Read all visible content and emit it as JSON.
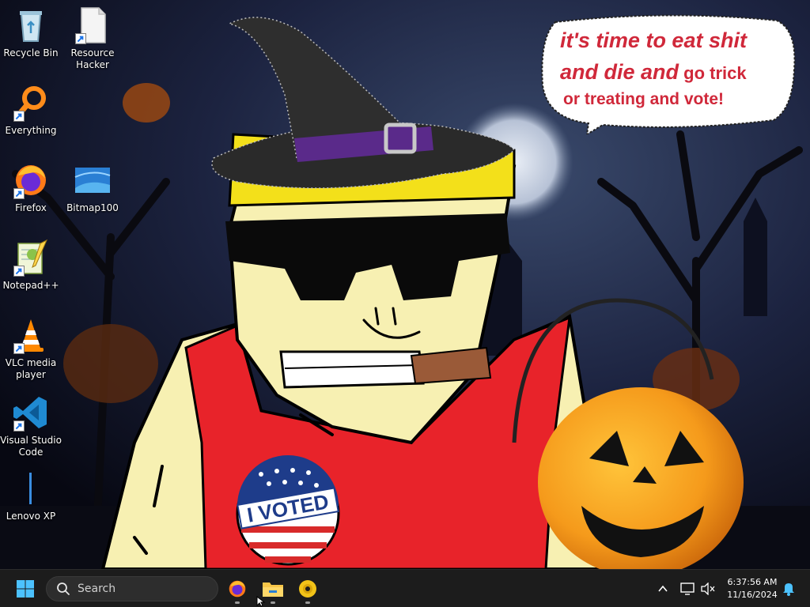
{
  "desktop": {
    "icons": [
      {
        "label": "Recycle Bin",
        "icon": "recycle-bin-icon",
        "shortcut": false
      },
      {
        "label": "Resource Hacker",
        "icon": "resource-hacker-icon",
        "shortcut": true
      },
      {
        "label": "Everything",
        "icon": "everything-search-icon",
        "shortcut": true
      },
      {
        "label": "Firefox",
        "icon": "firefox-icon",
        "shortcut": true
      },
      {
        "label": "Bitmap100",
        "icon": "bitmap-image-icon",
        "shortcut": false
      },
      {
        "label": "Notepad++",
        "icon": "notepad-plus-plus-icon",
        "shortcut": true
      },
      {
        "label": "VLC media player",
        "icon": "vlc-cone-icon",
        "shortcut": true
      },
      {
        "label": "Visual Studio Code",
        "icon": "vscode-icon",
        "shortcut": true
      },
      {
        "label": "Lenovo XP",
        "icon": "lenovo-xp-icon",
        "shortcut": false
      }
    ]
  },
  "wallpaper": {
    "speech_bubble": {
      "line1": "it's time to eat shit",
      "line2_big": "and die and",
      "line2_small": " go trick",
      "line3": "or treating and vote!"
    },
    "sticker_text": "I VOTED",
    "colors": {
      "speech_text": "#d0283a",
      "tank_top": "#e8232a",
      "skin": "#f7f0b2",
      "pumpkin": "#f59a1b"
    }
  },
  "taskbar": {
    "search_placeholder": "Search",
    "pinned": [
      {
        "name": "firefox-taskbar-button",
        "icon": "firefox-icon"
      },
      {
        "name": "file-explorer-taskbar-button",
        "icon": "folder-icon"
      },
      {
        "name": "media-disc-taskbar-button",
        "icon": "disc-icon"
      }
    ],
    "clock": {
      "time": "6:37:56 AM",
      "date": "11/16/2024"
    },
    "tray": [
      "chevron-up-icon",
      "network-icon",
      "volume-muted-icon",
      "notification-bell-icon"
    ],
    "colors": {
      "background": "#1c1c1c",
      "accent": "#4cc2ff"
    }
  }
}
